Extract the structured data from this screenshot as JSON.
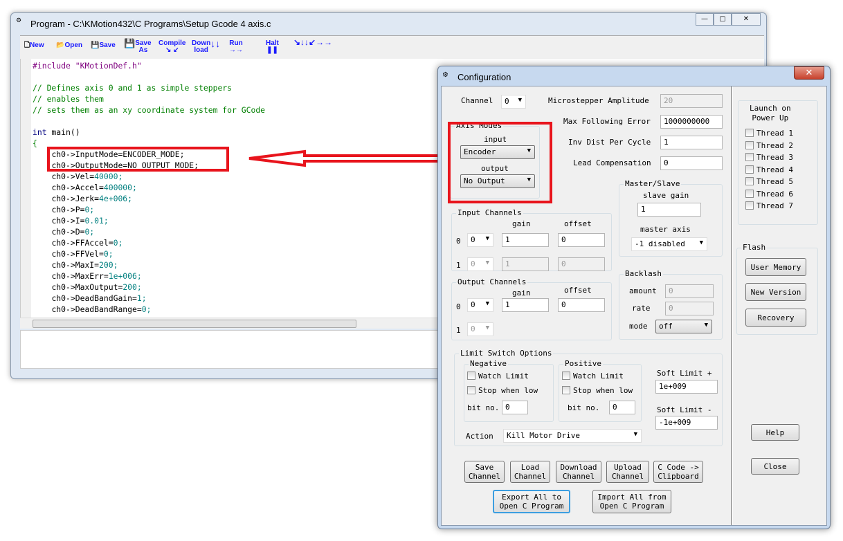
{
  "program_window": {
    "title": "Program - C:\\KMotion432\\C Programs\\Setup Gcode 4 axis.c",
    "toolbar": {
      "new": "New",
      "open": "Open",
      "save": "Save",
      "save_as_1": "Save",
      "save_as_2": "As",
      "compile": "Compile",
      "compile_arrows": "↘ ↙",
      "download_1": "Down",
      "download_2": "load",
      "run": "Run",
      "run_arrows": "→→",
      "halt": "Halt",
      "halt_glyph": "❚❚",
      "all_glyph": "↘↓↓↙→→"
    },
    "code": {
      "include_kw": "#include",
      "include_file": "\"KMotionDef.h\"",
      "comment1": "// Defines axis 0 and 1 as simple steppers",
      "comment2": "// enables them",
      "comment3": "// sets them as an xy coordinate system for GCode",
      "main_kw": "int",
      "main_rest": " main()",
      "brace": "{",
      "lines": [
        {
          "lhs": "ch0->InputMode=ENCODER_MODE;",
          "val": ""
        },
        {
          "lhs": "ch0->OutputMode=NO_OUTPUT_MODE;",
          "val": ""
        },
        {
          "lhs": "ch0->Vel=",
          "val": "40000;"
        },
        {
          "lhs": "ch0->Accel=",
          "val": "400000;"
        },
        {
          "lhs": "ch0->Jerk=",
          "val": "4e+006;"
        },
        {
          "lhs": "ch0->P=",
          "val": "0;"
        },
        {
          "lhs": "ch0->I=",
          "val": "0.01;"
        },
        {
          "lhs": "ch0->D=",
          "val": "0;"
        },
        {
          "lhs": "ch0->FFAccel=",
          "val": "0;"
        },
        {
          "lhs": "ch0->FFVel=",
          "val": "0;"
        },
        {
          "lhs": "ch0->MaxI=",
          "val": "200;"
        },
        {
          "lhs": "ch0->MaxErr=",
          "val": "1e+006;"
        },
        {
          "lhs": "ch0->MaxOutput=",
          "val": "200;"
        },
        {
          "lhs": "ch0->DeadBandGain=",
          "val": "1;"
        },
        {
          "lhs": "ch0->DeadBandRange=",
          "val": "0;"
        }
      ]
    }
  },
  "config_dialog": {
    "title": "Configuration",
    "channel_label": "Channel",
    "channel_value": "0",
    "microstepper_label": "Microstepper Amplitude",
    "microstepper_value": "20",
    "max_following_label": "Max Following Error",
    "max_following_value": "1000000000",
    "inv_dist_label": "Inv Dist Per Cycle",
    "inv_dist_value": "1",
    "lead_comp_label": "Lead Compensation",
    "lead_comp_value": "0",
    "axis_modes": {
      "title": "Axis Modes",
      "input_label": "input",
      "input_value": "Encoder",
      "output_label": "output",
      "output_value": "No Output"
    },
    "input_channels": {
      "title": "Input Channels",
      "gain": "gain",
      "offset": "offset",
      "row0": {
        "idx": "0",
        "ch": "0",
        "gain": "1",
        "offset": "0"
      },
      "row1": {
        "idx": "1",
        "ch": "0",
        "gain": "1",
        "offset": "0"
      }
    },
    "output_channels": {
      "title": "Output Channels",
      "gain": "gain",
      "offset": "offset",
      "row0": {
        "idx": "0",
        "ch": "0",
        "gain": "1",
        "offset": "0"
      },
      "row1": {
        "idx": "1",
        "ch": "0"
      }
    },
    "master_slave": {
      "title": "Master/Slave",
      "slave_gain_label": "slave gain",
      "slave_gain": "1",
      "master_axis_label": "master axis",
      "master_axis": "-1 disabled"
    },
    "backlash": {
      "title": "Backlash",
      "amount_label": "amount",
      "amount": "0",
      "rate_label": "rate",
      "rate": "0",
      "mode_label": "mode",
      "mode": "off"
    },
    "limit": {
      "title": "Limit Switch Options",
      "negative": "Negative",
      "positive": "Positive",
      "watch": "Watch Limit",
      "stop_low": "Stop when low",
      "bit_no": "bit no.",
      "neg_bit": "0",
      "pos_bit": "0",
      "soft_plus_label": "Soft Limit +",
      "soft_plus": "1e+009",
      "soft_minus_label": "Soft Limit -",
      "soft_minus": "-1e+009",
      "action_label": "Action",
      "action": "Kill Motor Drive"
    },
    "launch": {
      "title1": "Launch on",
      "title2": "Power Up",
      "threads": [
        "Thread 1",
        "Thread 2",
        "Thread 3",
        "Thread 4",
        "Thread 5",
        "Thread 6",
        "Thread 7"
      ]
    },
    "flash": {
      "title": "Flash",
      "user_memory": "User Memory",
      "new_version": "New Version",
      "recovery": "Recovery"
    },
    "buttons": {
      "save1": "Save",
      "save2": "Channel",
      "load1": "Load",
      "load2": "Channel",
      "dl1": "Download",
      "dl2": "Channel",
      "ul1": "Upload",
      "ul2": "Channel",
      "cc1": "C Code ->",
      "cc2": "Clipboard",
      "exp1": "Export All to",
      "exp2": "Open C Program",
      "imp1": "Import All from",
      "imp2": "Open C Program",
      "help": "Help",
      "close": "Close"
    }
  },
  "annotation": {
    "highlight_color": "#e8141c"
  }
}
